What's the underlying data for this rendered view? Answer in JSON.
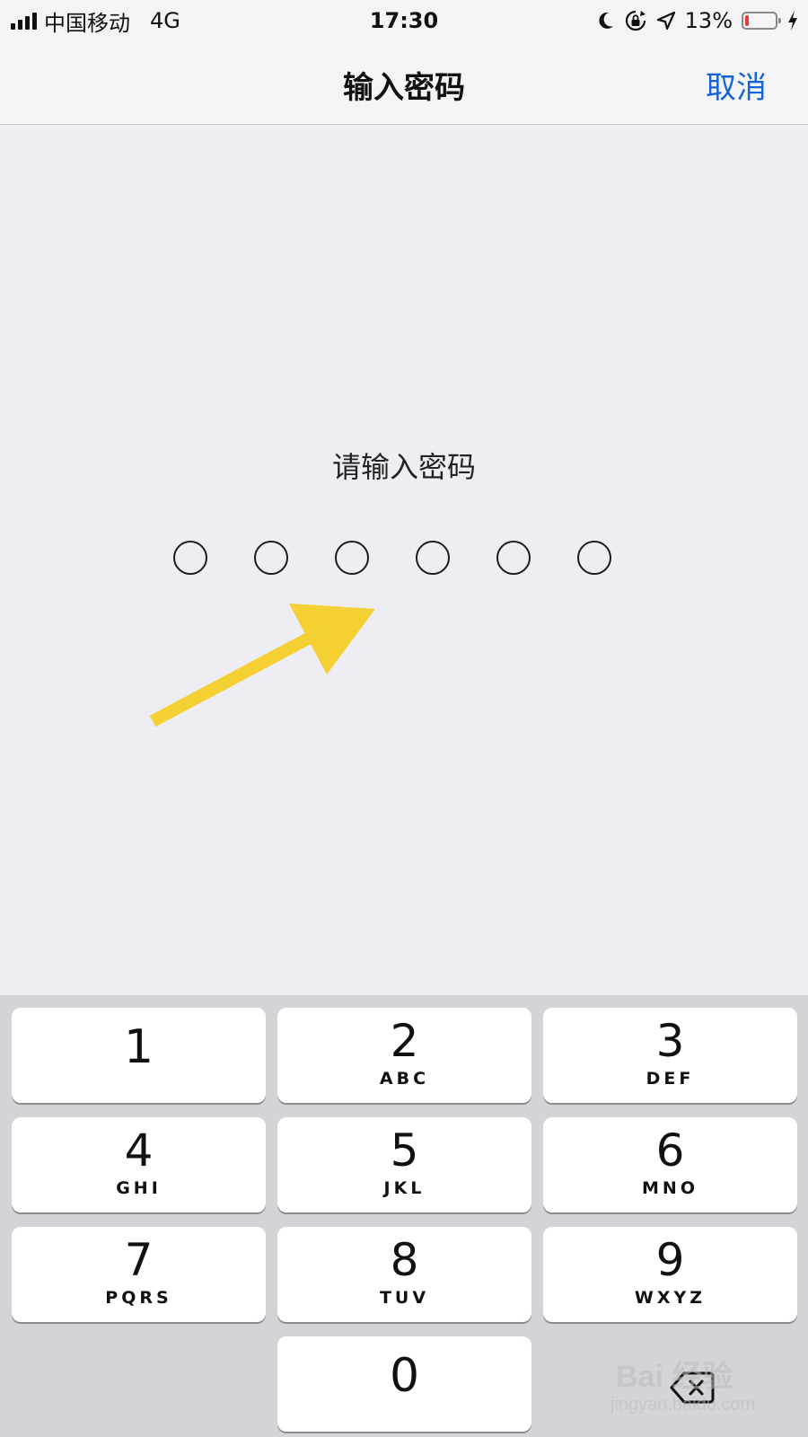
{
  "status_bar": {
    "carrier": "中国移动",
    "network": "4G",
    "time": "17:30",
    "battery_percent": "13%",
    "battery_level": 0.13,
    "battery_color": "#e53a36",
    "icons": [
      "signal-icon",
      "moon-icon",
      "rotation-lock-icon",
      "location-icon",
      "battery-icon",
      "charging-icon"
    ]
  },
  "nav": {
    "title": "输入密码",
    "cancel_label": "取消",
    "cancel_color": "#1464d7"
  },
  "passcode": {
    "prompt": "请输入密码",
    "length": 6,
    "entered": 0
  },
  "annotation": {
    "arrow_color": "#f5d033"
  },
  "keypad": {
    "keys": [
      {
        "digit": "1",
        "letters": ""
      },
      {
        "digit": "2",
        "letters": "ABC"
      },
      {
        "digit": "3",
        "letters": "DEF"
      },
      {
        "digit": "4",
        "letters": "GHI"
      },
      {
        "digit": "5",
        "letters": "JKL"
      },
      {
        "digit": "6",
        "letters": "MNO"
      },
      {
        "digit": "7",
        "letters": "PQRS"
      },
      {
        "digit": "8",
        "letters": "TUV"
      },
      {
        "digit": "9",
        "letters": "WXYZ"
      },
      {
        "digit": "0",
        "letters": ""
      }
    ],
    "delete_icon": "backspace-icon"
  },
  "watermark": {
    "brand": "Bai 经验",
    "domain": "jingyan.baidu.com"
  }
}
